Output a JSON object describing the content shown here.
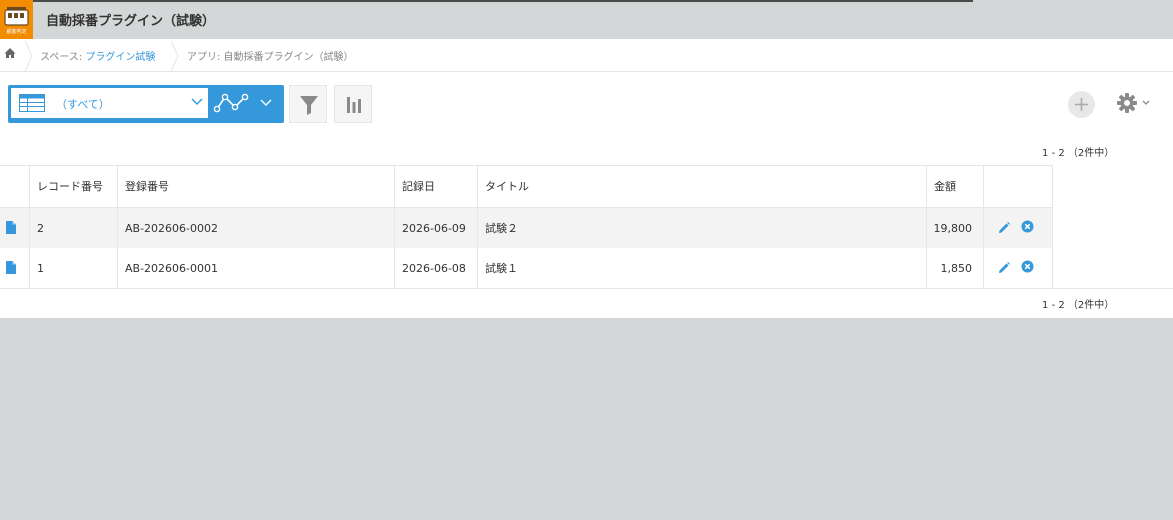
{
  "header": {
    "app_icon_caption": "顧客判定",
    "app_title": "自動採番プラグイン（試験）"
  },
  "breadcrumb": {
    "space_prefix": "スペース: ",
    "space_name": "プラグイン試験",
    "app": "アプリ: 自動採番プラグイン（試験）"
  },
  "toolbar": {
    "view_label": "（すべて）"
  },
  "pager": {
    "top": "1 - 2 （2件中）",
    "bottom": "1 - 2 （2件中）"
  },
  "table": {
    "columns": [
      "レコード番号",
      "登録番号",
      "記録日",
      "タイトル",
      "金額"
    ],
    "rows": [
      {
        "record_no": "2",
        "reg_no": "AB-202606-0002",
        "date": "2026-06-09",
        "title": "試験２",
        "amount": "19,800"
      },
      {
        "record_no": "1",
        "reg_no": "AB-202606-0001",
        "date": "2026-06-08",
        "title": "試験１",
        "amount": "1,850"
      }
    ]
  },
  "colors": {
    "accent": "#3498db",
    "app_icon": "#f28c00",
    "background": "#d4d7d7"
  },
  "icons": [
    "home-icon",
    "table-view-icon",
    "chevron-down-icon",
    "graph-icon",
    "filter-icon",
    "bar-chart-icon",
    "plus-icon",
    "gear-icon",
    "document-icon",
    "pencil-icon",
    "delete-icon"
  ]
}
